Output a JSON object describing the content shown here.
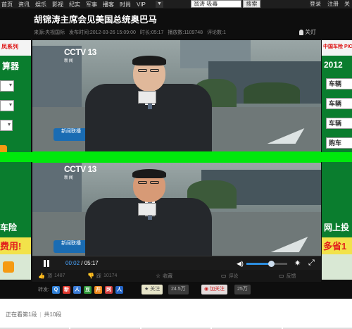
{
  "nav": {
    "items": [
      "首页",
      "资讯",
      "娱乐",
      "影视",
      "纪实",
      "军事",
      "播客",
      "时尚",
      "VIP"
    ],
    "caret": "▼",
    "search_value": "翁涛 吸毒",
    "search_button": "搜索",
    "login": "登录",
    "register": "注册",
    "close": "关"
  },
  "video": {
    "title": "胡锦涛主席会见美国总统奥巴马",
    "source": "来源:央视国际",
    "published": "发布时间:2012-03-26 15:09:00",
    "duration": "时长:05:17",
    "plays": "播放数:1109748",
    "comments_count": "评论数:1",
    "lights_off": "关灯",
    "channel_logo": "CCTV 13",
    "channel_sub": "新 闻",
    "program_badge": "新闻联播"
  },
  "controls": {
    "current_time": "00:02",
    "total_time": "05:17",
    "separator": " / ",
    "volume_level": 0.6
  },
  "actions": {
    "top": {
      "label": "顶",
      "count": "1487"
    },
    "down": {
      "label": "踩",
      "count": "10174"
    },
    "favorite": "收藏",
    "comment": "评论",
    "feedback": "反馈"
  },
  "share": {
    "label": "转发:",
    "icons": [
      "Q",
      "新",
      "人",
      "豆",
      "开",
      "网",
      "人"
    ],
    "fav_button": "关注",
    "fav_count": "24.5万",
    "follow_button": "加关注",
    "follow_count": "25万"
  },
  "ads": {
    "left": {
      "header": "凤系列",
      "title": "算器",
      "insurance": "车险",
      "promo": "费用!"
    },
    "right": {
      "header": "中国车险 PIC",
      "year": "2012",
      "fields": [
        "车辆",
        "车辆",
        "车辆",
        "购车"
      ],
      "online": "网上投",
      "promo": "多省1"
    }
  },
  "playlist": {
    "now_playing": "正在看第1段",
    "total": "共10段"
  }
}
